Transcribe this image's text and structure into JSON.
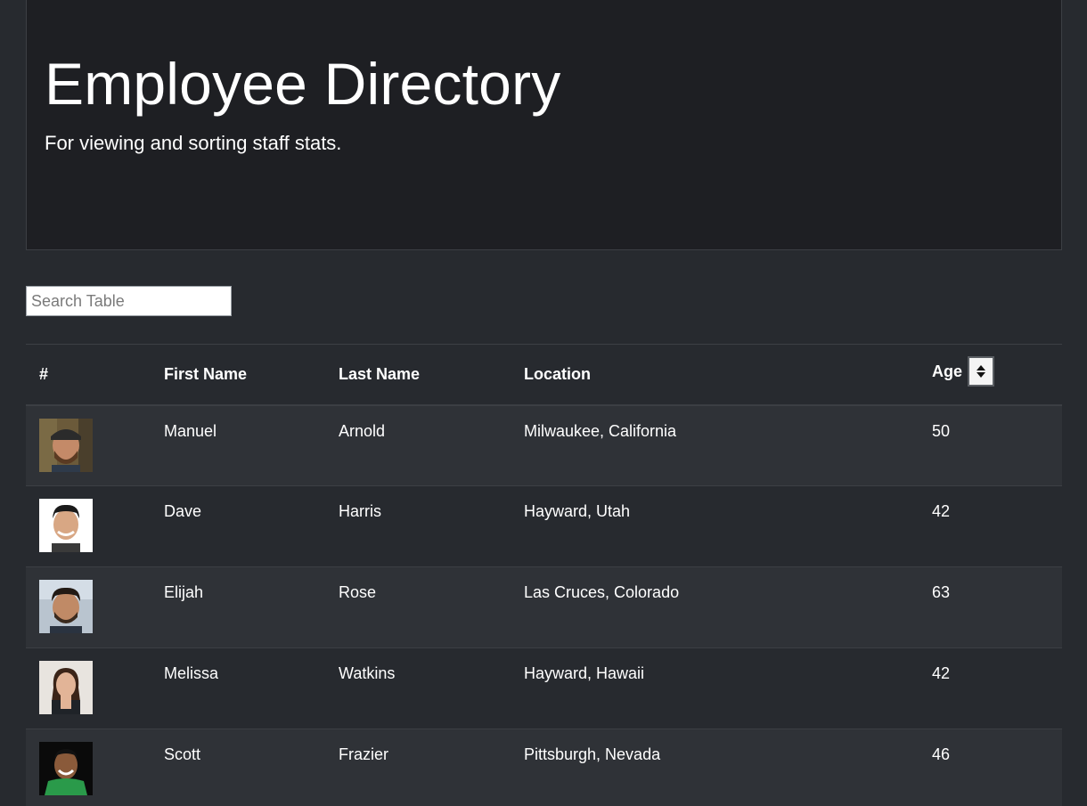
{
  "header": {
    "title": "Employee Directory",
    "subtitle": "For viewing and sorting staff stats."
  },
  "search": {
    "placeholder": "Search Table",
    "value": ""
  },
  "table": {
    "columns": {
      "num": "#",
      "first": "First Name",
      "last": "Last Name",
      "location": "Location",
      "age": "Age"
    },
    "sort_icon": "sort-up-down-icon",
    "rows": [
      {
        "first": "Manuel",
        "last": "Arnold",
        "location": "Milwaukee, California",
        "age": "50"
      },
      {
        "first": "Dave",
        "last": "Harris",
        "location": "Hayward, Utah",
        "age": "42"
      },
      {
        "first": "Elijah",
        "last": "Rose",
        "location": "Las Cruces, Colorado",
        "age": "63"
      },
      {
        "first": "Melissa",
        "last": "Watkins",
        "location": "Hayward, Hawaii",
        "age": "42"
      },
      {
        "first": "Scott",
        "last": "Frazier",
        "location": "Pittsburgh, Nevada",
        "age": "46"
      }
    ]
  },
  "colors": {
    "page_bg": "#272a2f",
    "header_bg": "#1e1f23",
    "row_alt_bg": "#2f3237",
    "text": "#ffffff"
  }
}
